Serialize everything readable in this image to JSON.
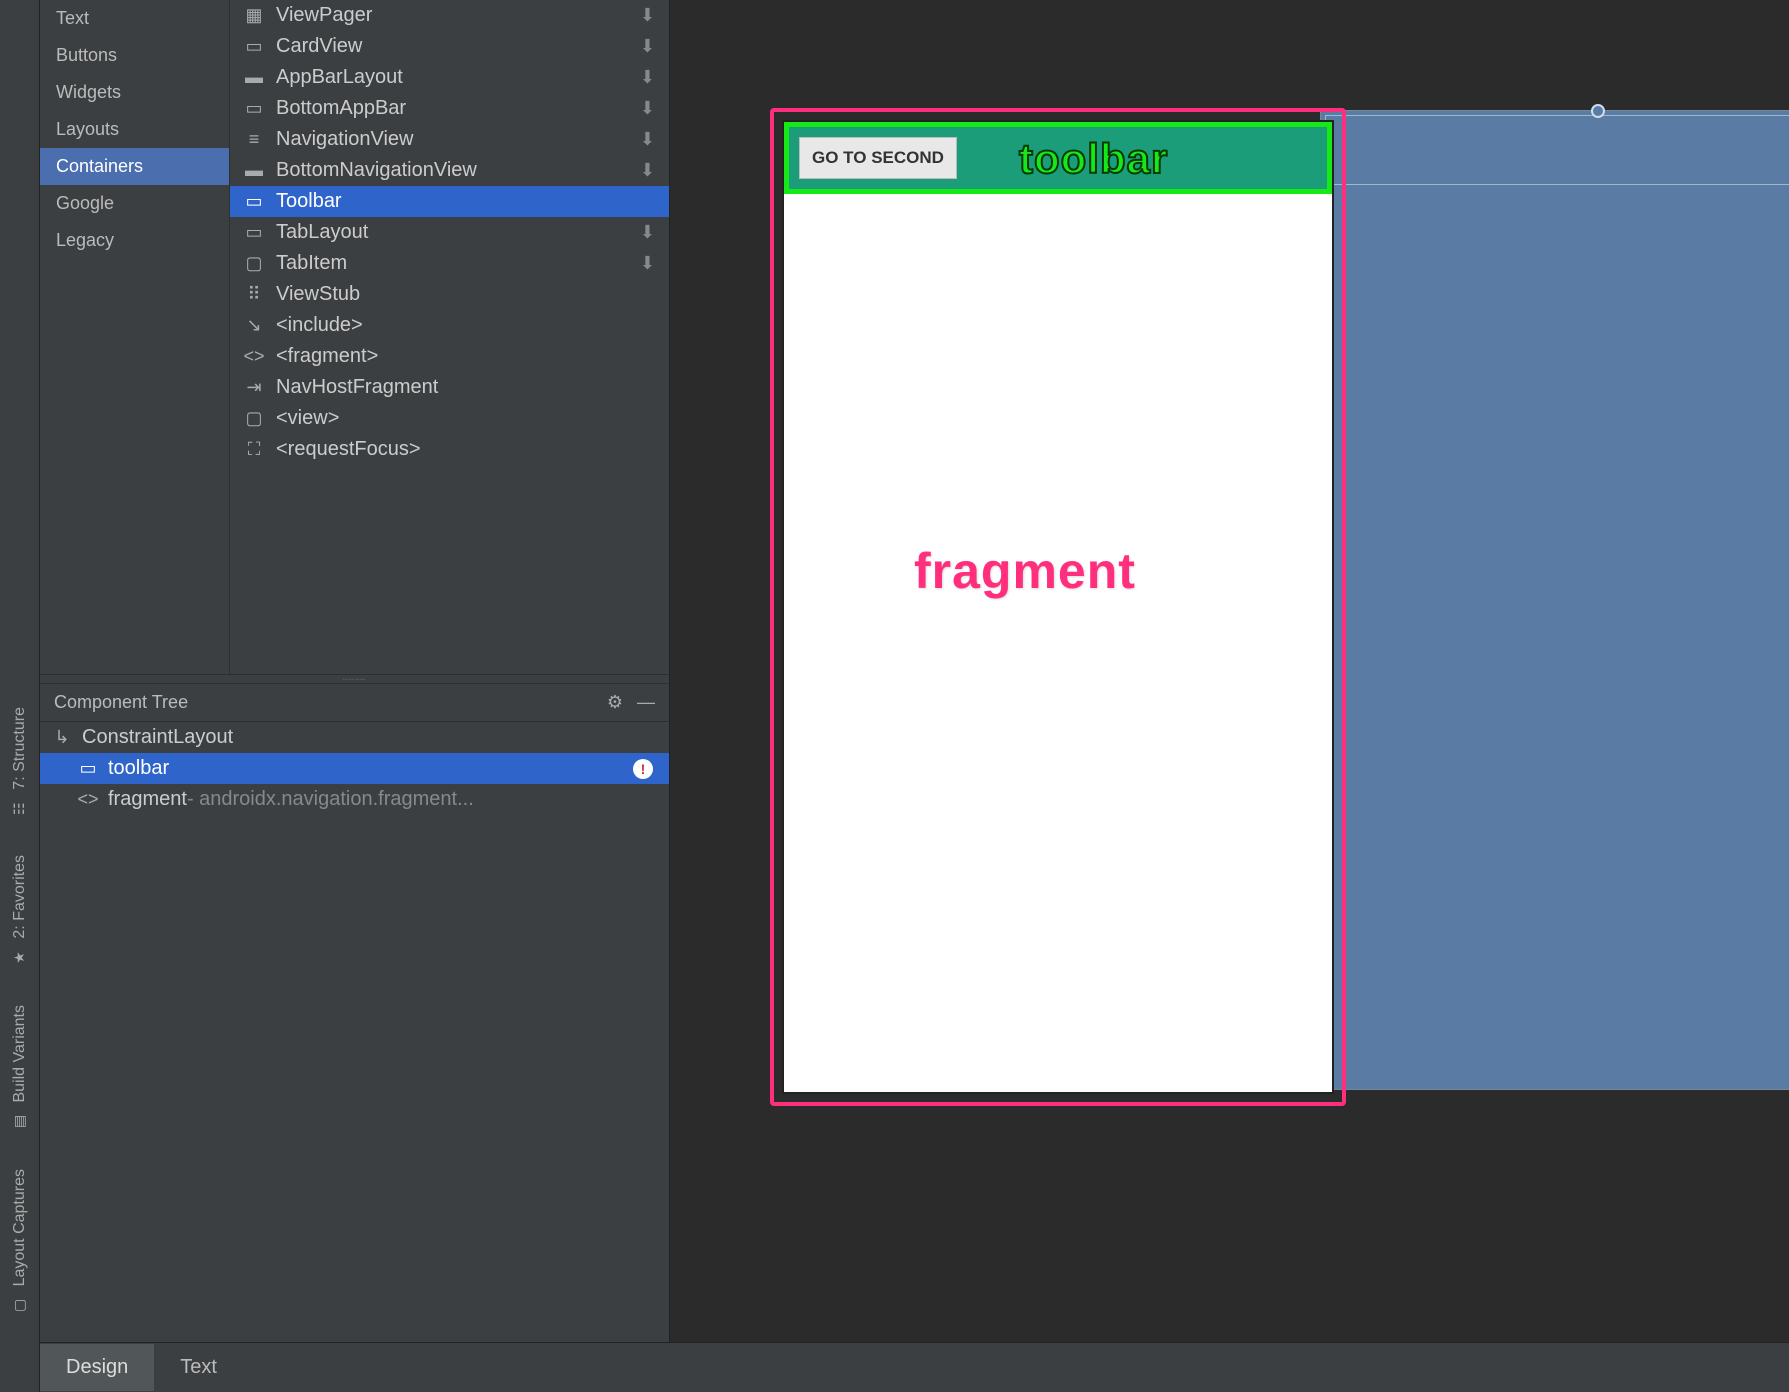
{
  "tool_strip": {
    "items": [
      {
        "label": "7: Structure",
        "icon": "☷"
      },
      {
        "label": "2: Favorites",
        "icon": "★"
      },
      {
        "label": "Build Variants",
        "icon": "▤"
      },
      {
        "label": "Layout Captures",
        "icon": "▢"
      }
    ]
  },
  "palette": {
    "categories": [
      {
        "label": "Text"
      },
      {
        "label": "Buttons"
      },
      {
        "label": "Widgets"
      },
      {
        "label": "Layouts"
      },
      {
        "label": "Containers",
        "selected": true
      },
      {
        "label": "Google"
      },
      {
        "label": "Legacy"
      }
    ],
    "widgets": [
      {
        "icon": "▦",
        "label": "ViewPager",
        "download": true
      },
      {
        "icon": "▭",
        "label": "CardView",
        "download": true
      },
      {
        "icon": "▬",
        "label": "AppBarLayout",
        "download": true
      },
      {
        "icon": "▭",
        "label": "BottomAppBar",
        "download": true
      },
      {
        "icon": "≡",
        "label": "NavigationView",
        "download": true
      },
      {
        "icon": "▬",
        "label": "BottomNavigationView",
        "download": true
      },
      {
        "icon": "▭",
        "label": "Toolbar",
        "selected": true
      },
      {
        "icon": "▭",
        "label": "TabLayout",
        "download": true
      },
      {
        "icon": "▢",
        "label": "TabItem",
        "download": true
      },
      {
        "icon": "⠿",
        "label": "ViewStub"
      },
      {
        "icon": "↘",
        "label": "<include>"
      },
      {
        "icon": "<>",
        "label": "<fragment>"
      },
      {
        "icon": "⇥",
        "label": "NavHostFragment"
      },
      {
        "icon": "▢",
        "label": "<view>"
      },
      {
        "icon": "⛶",
        "label": "<requestFocus>"
      }
    ]
  },
  "component_tree": {
    "header": "Component Tree",
    "gear": "⚙",
    "collapse": "—",
    "root": {
      "icon": "↳",
      "label": "ConstraintLayout",
      "children": [
        {
          "icon": "▭",
          "label": "toolbar",
          "selected": true,
          "warning": true
        },
        {
          "icon": "<>",
          "label": "fragment",
          "suffix": "- androidx.navigation.fragment..."
        }
      ]
    }
  },
  "bottom_tabs": [
    {
      "label": "Design",
      "selected": true
    },
    {
      "label": "Text"
    }
  ],
  "preview": {
    "button_label": "GO TO SECOND",
    "annotation_toolbar": "toolbar",
    "annotation_fragment": "fragment"
  }
}
